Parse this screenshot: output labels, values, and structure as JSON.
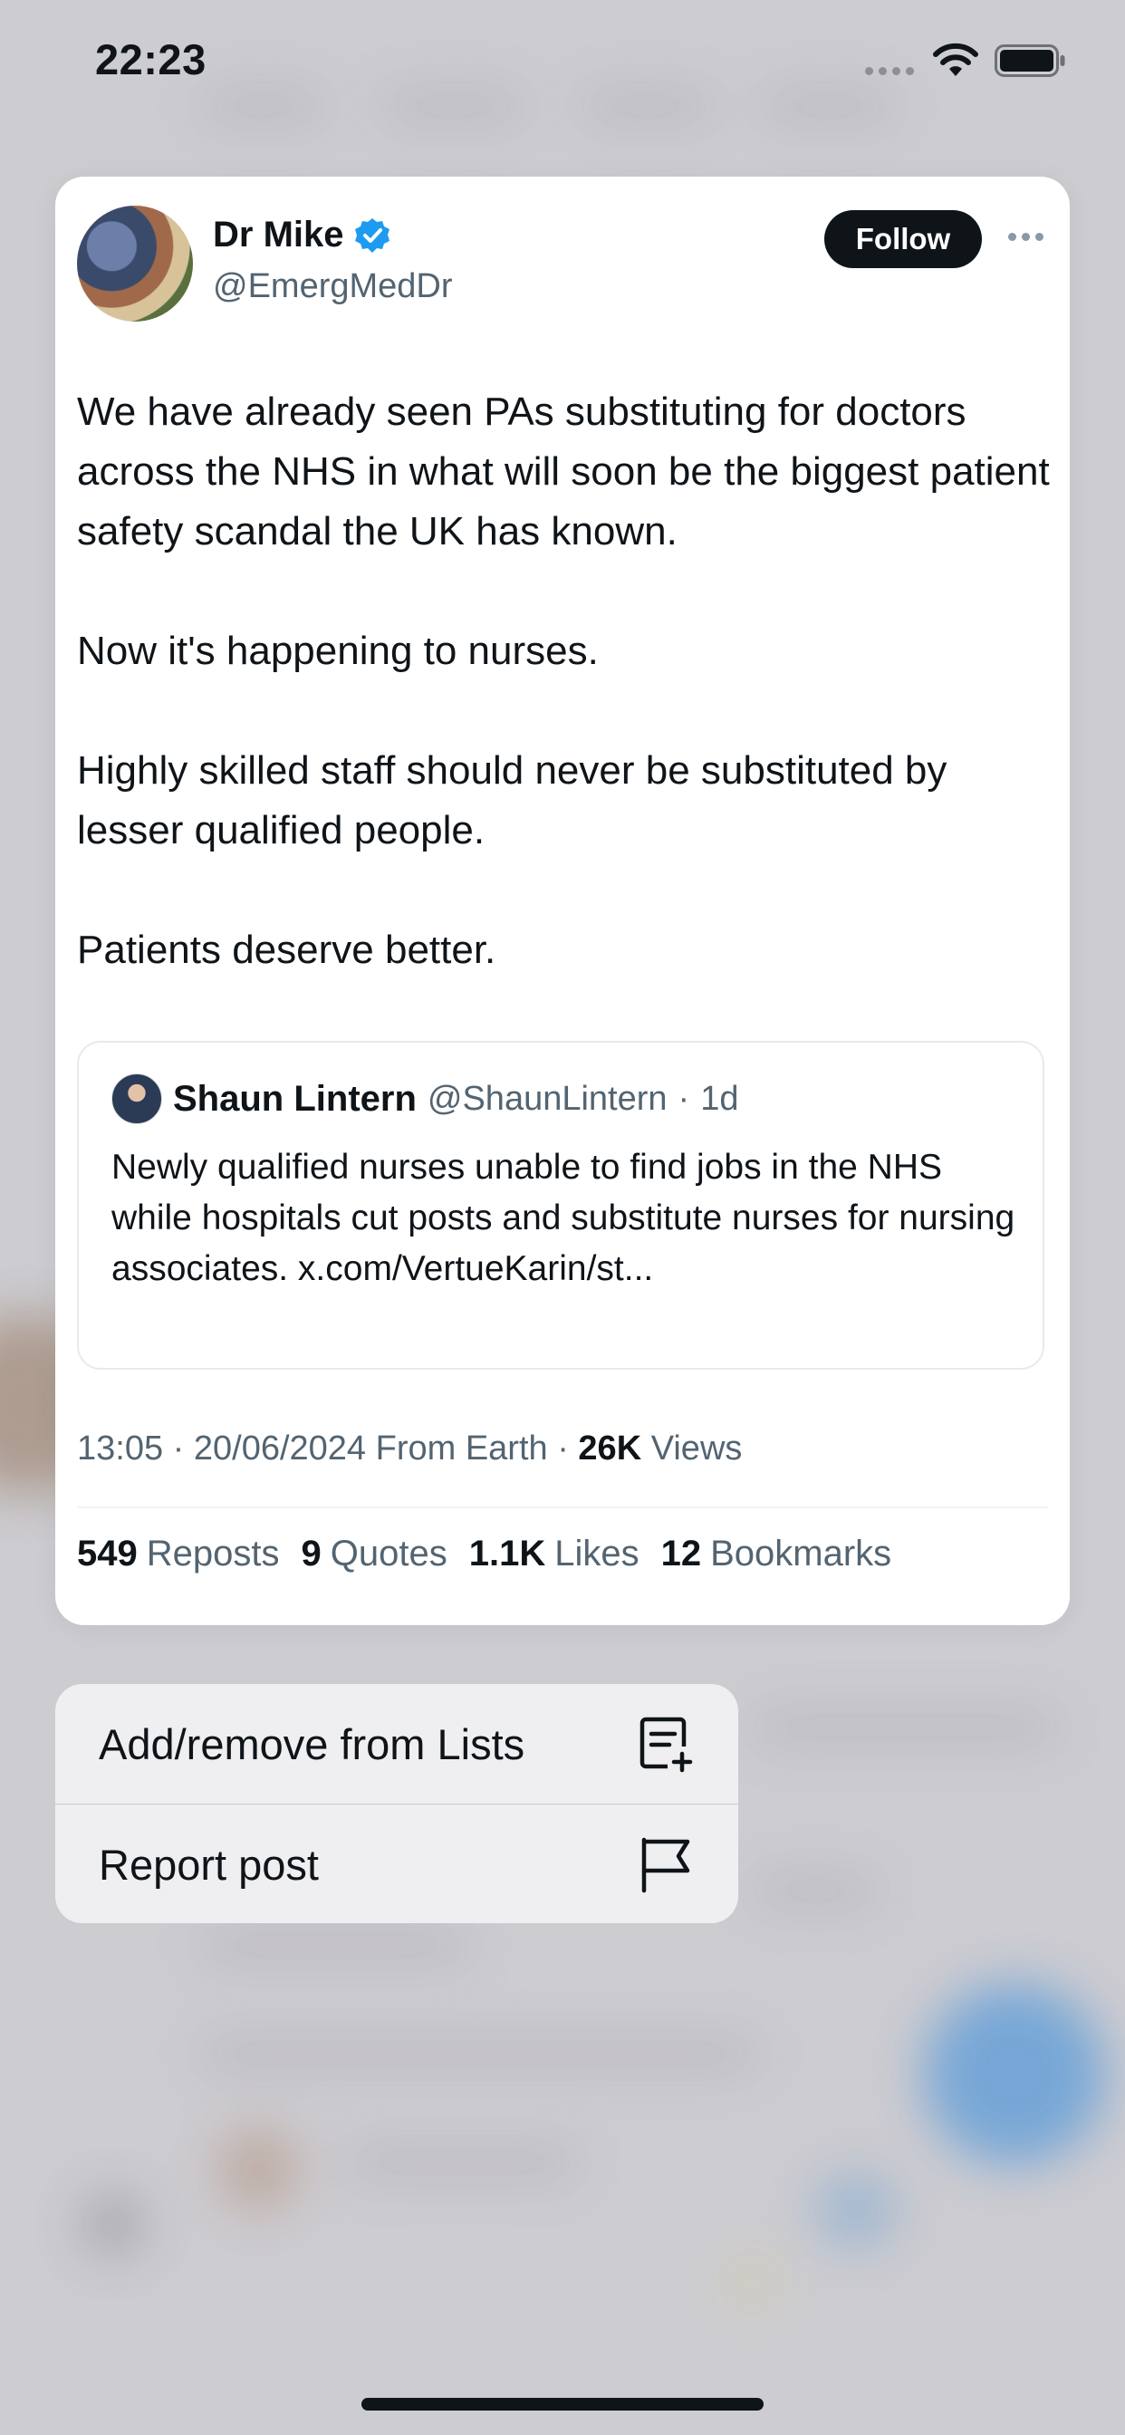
{
  "status_bar": {
    "time": "22:23"
  },
  "post": {
    "author": {
      "name": "Dr Mike",
      "handle": "@EmergMedDr",
      "verified_color": "#1d9bf0"
    },
    "follow_label": "Follow",
    "paragraphs": [
      "We have already seen PAs substituting for doctors across the NHS in what will soon be the biggest patient safety scandal the UK has known.",
      "Now it's happening to nurses.",
      "Highly skilled staff should never be substituted by lesser qualified people.",
      "Patients deserve better."
    ],
    "quote": {
      "name": "Shaun Lintern",
      "handle": "@ShaunLintern",
      "separator": "·",
      "time": "1d",
      "text": "Newly qualified nurses unable to find jobs in the NHS while hospitals cut posts and substitute nurses for nursing associates. x.com/VertueKarin/st..."
    },
    "meta": {
      "timestamp": "13:05 · 20/06/2024 From Earth ·",
      "views_count": "26K",
      "views_label": "Views"
    },
    "stats": [
      {
        "value": "549",
        "label": "Reposts"
      },
      {
        "value": "9",
        "label": "Quotes"
      },
      {
        "value": "1.1K",
        "label": "Likes"
      },
      {
        "value": "12",
        "label": "Bookmarks"
      }
    ]
  },
  "menu": {
    "items": [
      {
        "label": "Add/remove from Lists",
        "icon": "list-add-icon"
      },
      {
        "label": "Report post",
        "icon": "flag-icon"
      }
    ]
  },
  "colors": {
    "text_primary": "#0f1419",
    "text_secondary": "#536471",
    "accent": "#1d9bf0",
    "background_dim": "#cdccd1"
  }
}
